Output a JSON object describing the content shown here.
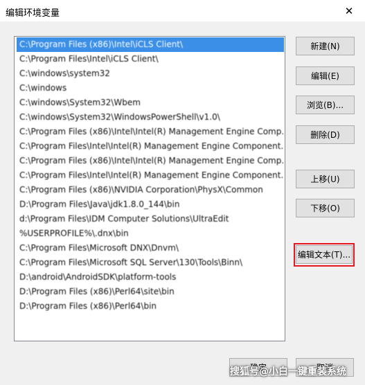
{
  "window": {
    "title": "编辑环境变量",
    "close_glyph": "✕"
  },
  "list": {
    "items": [
      "C:\\Program Files (x86)\\Intel\\iCLS Client\\",
      "C:\\Program Files\\Intel\\iCLS Client\\",
      "C:\\windows\\system32",
      "C:\\windows",
      "C:\\windows\\System32\\Wbem",
      "C:\\windows\\System32\\WindowsPowerShell\\v1.0\\",
      "C:\\Program Files (x86)\\Intel\\Intel(R) Management Engine Comp...",
      "C:\\Program Files\\Intel\\Intel(R) Management Engine Component...",
      "C:\\Program Files (x86)\\Intel\\Intel(R) Management Engine Comp...",
      "C:\\Program Files\\Intel\\Intel(R) Management Engine Component...",
      "C:\\Program Files (x86)\\NVIDIA Corporation\\PhysX\\Common",
      "D:\\Program Files\\Java\\jdk1.8.0_144\\bin",
      "d:\\Program Files\\IDM Computer Solutions\\UltraEdit",
      "%USERPROFILE%\\.dnx\\bin",
      "C:\\Program Files\\Microsoft DNX\\Dnvm\\",
      "C:\\Program Files\\Microsoft SQL Server\\130\\Tools\\Binn\\",
      "D:\\android\\AndroidSDK\\platform-tools",
      "D:\\Program Files (x86)\\Perl64\\site\\bin",
      "D:\\Program Files (x86)\\Perl64\\bin"
    ]
  },
  "buttons": {
    "new": "新建(N)",
    "edit": "编辑(E)",
    "browse": "浏览(B)...",
    "delete": "删除(D)",
    "move_up": "上移(U)",
    "move_down": "下移(O)",
    "edit_text": "编辑文本(T)...",
    "ok": "确定",
    "cancel": "取消"
  },
  "watermark": "搜狐号@小白一键重装系统",
  "colors": {
    "selection": "#3b8fe6",
    "highlight_frame": "#e8141f",
    "button_face": "#e1e1e1",
    "client_bg": "#f0f0f0"
  }
}
